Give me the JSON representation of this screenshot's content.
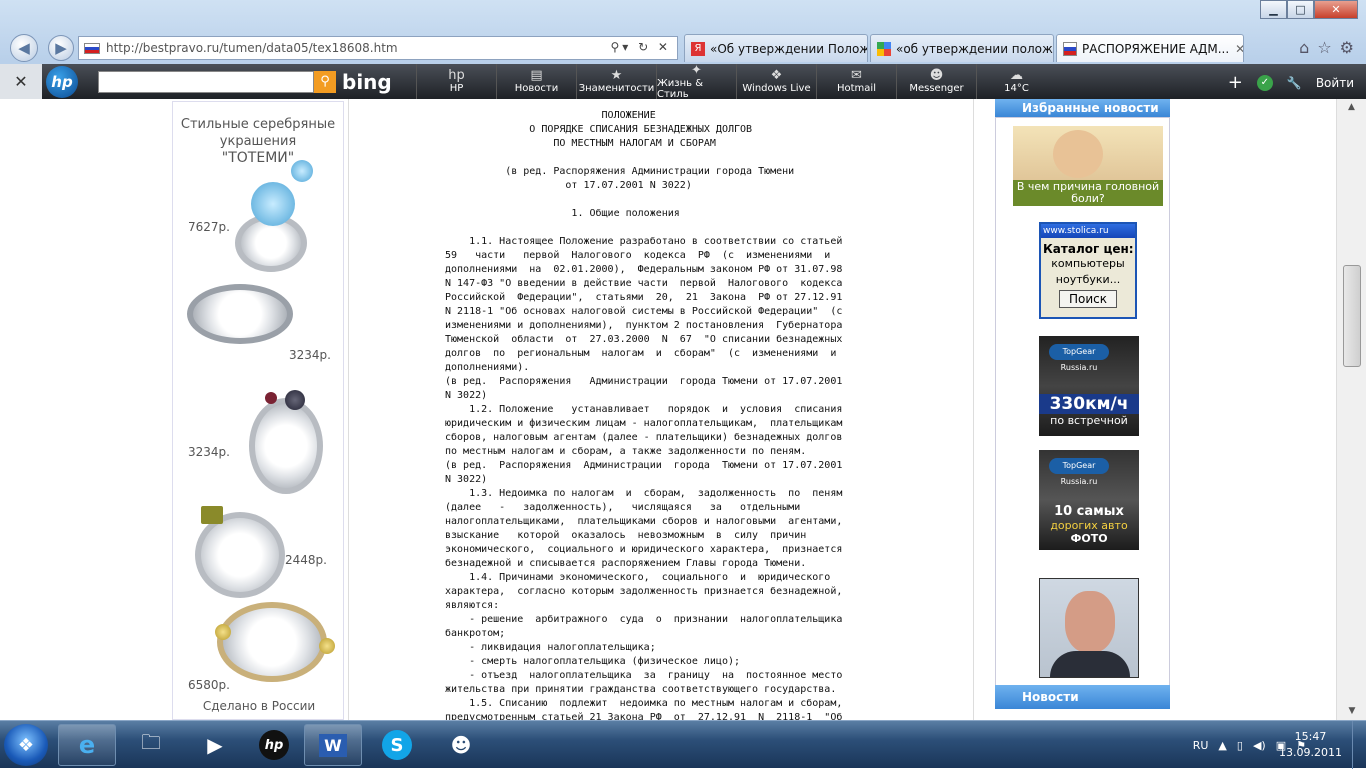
{
  "browser": {
    "url": "http://bestpravo.ru/tumen/data05/tex18608.htm",
    "tabs": [
      {
        "label": "«Об утверждении Положе...",
        "icon": "yandex-icon",
        "active": false
      },
      {
        "label": "«об утверждении положе...",
        "icon": "google-icon",
        "active": false
      },
      {
        "label": "РАСПОРЯЖЕНИЕ АДМ...",
        "icon": "russia-flag-icon",
        "active": true
      }
    ]
  },
  "hp_toolbar": {
    "search_brand": "bing",
    "items": [
      {
        "label": "HP",
        "icon": "hp"
      },
      {
        "label": "Новости",
        "icon": "▤"
      },
      {
        "label": "Знаменитости",
        "icon": "★"
      },
      {
        "label": "Жизнь & Стиль",
        "icon": "✦"
      },
      {
        "label": "Windows Live",
        "icon": "❖"
      },
      {
        "label": "Hotmail",
        "icon": "✉"
      },
      {
        "label": "Messenger",
        "icon": "☻"
      },
      {
        "label": "14°C",
        "icon": "☁"
      }
    ],
    "login": "Войти"
  },
  "left_ad": {
    "title": "Стильные серебряные украшения",
    "brand": "\"ТОТЕМИ\"",
    "prices": [
      "7627р.",
      "3234р.",
      "3234р.",
      "2448р.",
      "6580р."
    ],
    "footer": "Сделано в России"
  },
  "document": {
    "text": "                          ПОЛОЖЕНИЕ\n              О ПОРЯДКЕ СПИСАНИЯ БЕЗНАДЕЖНЫХ ДОЛГОВ\n                  ПО МЕСТНЫМ НАЛОГАМ И СБОРАМ\n\n          (в ред. Распоряжения Администрации города Тюмени\n                    от 17.07.2001 N 3022)\n\n                     1. Общие положения\n\n    1.1. Настоящее Положение разработано в соответствии со статьей\n59   части   первой  Налогового  кодекса  РФ  (с  изменениями  и\nдополнениями  на  02.01.2000),  Федеральным законом РФ от 31.07.98\nN 147-ФЗ \"О введении в действие части  первой  Налогового  кодекса\nРоссийской  Федерации\",  статьями  20,  21  Закона  РФ от 27.12.91\nN 2118-1 \"Об основах налоговой системы в Российской Федерации\"  (с\nизменениями и дополнениями),  пунктом 2 постановления  Губернатора\nТюменской  области  от  27.03.2000  N  67  \"О списании безнадежных\nдолгов  по  региональным  налогам  и  сборам\"  (с  изменениями  и\nдополнениями).\n(в ред.  Распоряжения   Администрации  города Тюмени от 17.07.2001\nN 3022)\n    1.2. Положение   устанавливает   порядок  и  условия  списания\nюридическим и физическим лицам - налогоплательщикам,  плательщикам\nсборов, налоговым агентам (далее - плательщики) безнадежных долгов\nпо местным налогам и сборам, а также задолженности по пеням.\n(в ред.  Распоряжения  Администрации  города  Тюмени от 17.07.2001\nN 3022)\n    1.3. Недоимка по налогам  и  сборам,  задолженность  по  пеням\n(далее   -   задолженность),   числящаяся   за   отдельными\nналогоплательщиками,  плательщиками сборов и налоговыми  агентами,\nвзыскание   которой  оказалось  невозможным  в  силу  причин\nэкономического,  социального и юридического характера,  признается\nбезнадежной и списывается распоряжением Главы города Тюмени.\n    1.4. Причинами экономического,  социального  и  юридического\nхарактера,  согласно которым задолженность признается безнадежной,\nявляются:\n    - решение  арбитражного  суда  о  признании  налогоплательщика\nбанкротом;\n    - ликвидация налогоплательщика;\n    - смерть налогоплательщика (физическое лицо);\n    - отъезд  налогоплательщика  за  границу  на  постоянное место\nжительства при принятии гражданства соответствующего государства.\n    1.5. Списанию  подлежит  недоимка по местным налогам и сборам,\nпредусмотренным статьей 21 Закона РФ  от  27.12.91  N  2118-1  \"Об"
  },
  "right_col": {
    "featured_header": "Избранные новости",
    "ad1_caption": "В чем причина головной боли?",
    "ad2": {
      "site": "www.stolica.ru",
      "title": "Каталог цен:",
      "line1": "компьютеры",
      "line2": "ноутбуки...",
      "button": "Поиск"
    },
    "ad3": {
      "badge": "TopGear Russia.ru",
      "big": "330км/ч",
      "small": "по встречной"
    },
    "ad4": {
      "badge": "TopGear Russia.ru",
      "big": "10 самых",
      "line2": "дорогих авто",
      "line3": "ФОТО"
    },
    "news_header": "Новости"
  },
  "taskbar": {
    "lang": "RU",
    "time": "15:47",
    "date": "13.09.2011"
  }
}
